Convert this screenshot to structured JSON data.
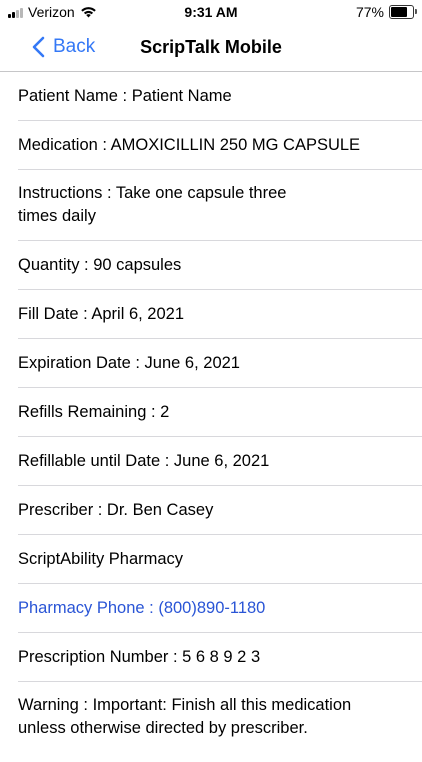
{
  "status_bar": {
    "carrier": "Verizon",
    "time": "9:31 AM",
    "battery_percent": "77%",
    "battery_level": 0.77,
    "signal_bars_filled": 2,
    "signal_bars_total": 4
  },
  "nav": {
    "back_label": "Back",
    "title": "ScripTalk Mobile",
    "accent_color": "#3478f6"
  },
  "rows": {
    "patient_name": "Patient Name : Patient Name",
    "medication": "Medication : AMOXICILLIN 250 MG CAPSULE",
    "instructions_line1": "Instructions : Take one capsule three",
    "instructions_line2": "times daily",
    "quantity": "Quantity : 90 capsules",
    "fill_date": "Fill Date :  April 6, 2021",
    "expiration_date": "Expiration Date :  June 6, 2021",
    "refills_remaining": "Refills Remaining : 2",
    "refillable_until": "Refillable until Date :  June 6, 2021",
    "prescriber": "Prescriber : Dr. Ben Casey",
    "pharmacy": "ScriptAbility Pharmacy",
    "pharmacy_phone": "Pharmacy Phone  :  (800)890-1180",
    "prescription_number": "Prescription Number :  5 6 8 9 2 3",
    "warning_line1": "Warning : Important: Finish all this medication",
    "warning_line2": "unless otherwise directed by prescriber."
  },
  "colors": {
    "link": "#2a55d6",
    "separator": "#d8d8dc"
  }
}
